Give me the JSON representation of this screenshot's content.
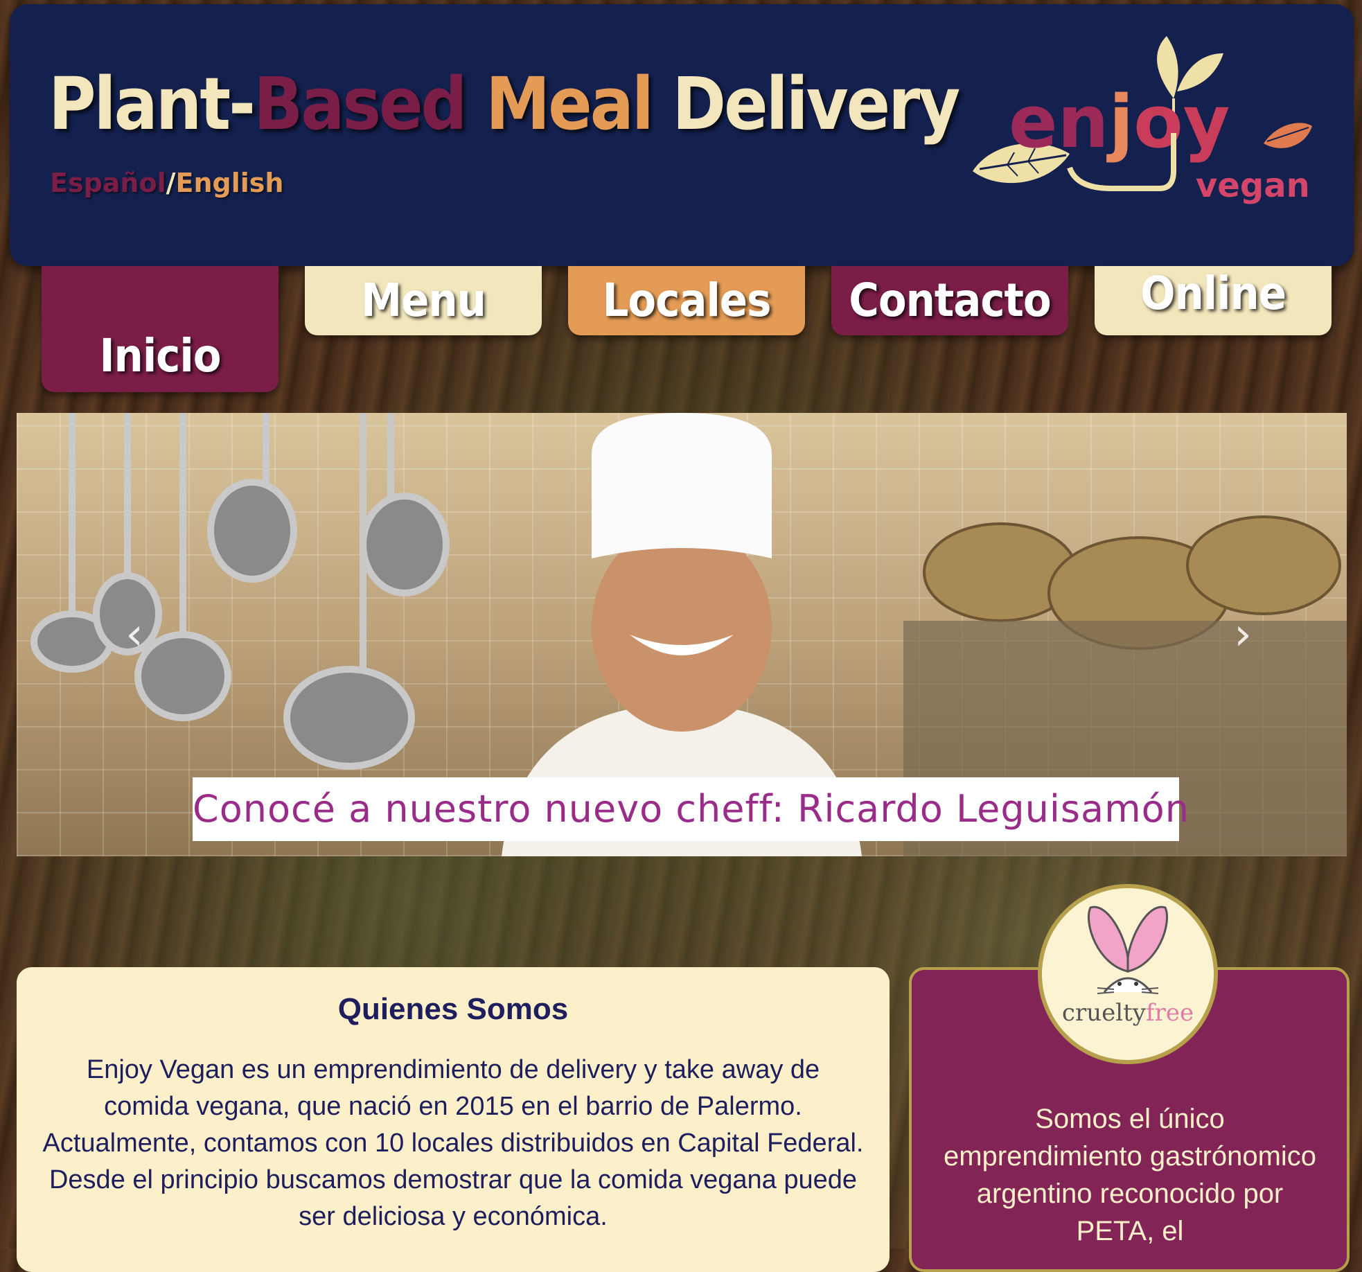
{
  "header": {
    "title_parts": [
      "Plant-",
      "Based",
      " Meal",
      " Delivery"
    ],
    "lang_es": "Español",
    "lang_sep": "/",
    "lang_en": "English",
    "logo_main": "enjoy",
    "logo_sub": "vegan"
  },
  "nav": {
    "inicio": "Inicio",
    "menu": "Menu",
    "locales": "Locales",
    "contacto": "Contacto",
    "online": "Online"
  },
  "carousel": {
    "caption": "Conocé a nuestro nuevo cheff: Ricardo Leguisamón",
    "prev_icon": "chevron-left-icon",
    "next_icon": "chevron-right-icon"
  },
  "about": {
    "heading": "Quienes Somos",
    "body": "Enjoy Vegan es un emprendimiento de delivery y take away de comida vegana, que nació en 2015 en el barrio de Palermo. Actualmente, contamos con 10 locales distribuidos en Capital Federal. Desde el principio buscamos demostrar que la comida vegana puede ser deliciosa y económica."
  },
  "peta": {
    "badge_word1": "cruelty",
    "badge_word2": "free",
    "text": "Somos el único emprendimiento gastrónomico argentino reconocido por PETA, el"
  },
  "colors": {
    "navy": "#14214f",
    "plum": "#7a1d47",
    "orange": "#e39b55",
    "cream": "#f2e6bc"
  }
}
